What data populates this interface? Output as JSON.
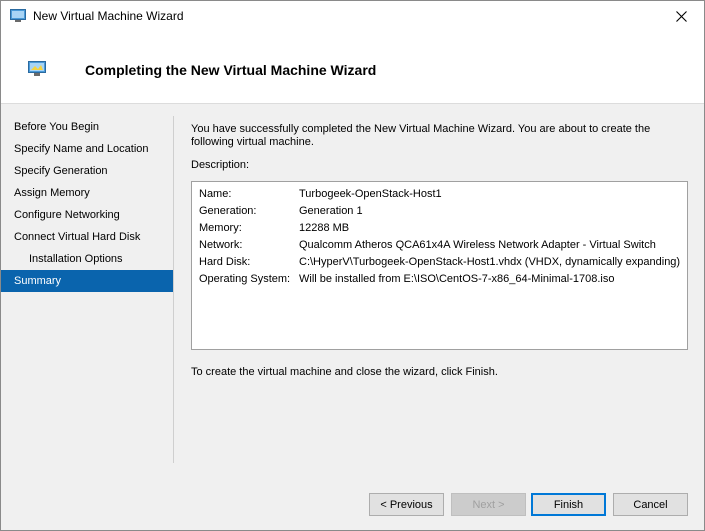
{
  "window": {
    "title": "New Virtual Machine Wizard",
    "header_title": "Completing the New Virtual Machine Wizard"
  },
  "nav": {
    "items": [
      {
        "label": "Before You Begin"
      },
      {
        "label": "Specify Name and Location"
      },
      {
        "label": "Specify Generation"
      },
      {
        "label": "Assign Memory"
      },
      {
        "label": "Configure Networking"
      },
      {
        "label": "Connect Virtual Hard Disk"
      },
      {
        "label": "Installation Options"
      },
      {
        "label": "Summary"
      }
    ]
  },
  "content": {
    "intro": "You have successfully completed the New Virtual Machine Wizard. You are about to create the following virtual machine.",
    "description_label": "Description:",
    "rows": [
      {
        "key": "Name:",
        "value": "Turbogeek-OpenStack-Host1"
      },
      {
        "key": "Generation:",
        "value": "Generation 1"
      },
      {
        "key": "Memory:",
        "value": "12288 MB"
      },
      {
        "key": "Network:",
        "value": "Qualcomm Atheros QCA61x4A Wireless Network Adapter - Virtual Switch"
      },
      {
        "key": "Hard Disk:",
        "value": "C:\\HyperV\\Turbogeek-OpenStack-Host1.vhdx (VHDX, dynamically expanding)"
      },
      {
        "key": "Operating System:",
        "value": "Will be installed from E:\\ISO\\CentOS-7-x86_64-Minimal-1708.iso"
      }
    ],
    "finish_text": "To create the virtual machine and close the wizard, click Finish."
  },
  "buttons": {
    "previous": "< Previous",
    "next": "Next >",
    "finish": "Finish",
    "cancel": "Cancel"
  },
  "colors": {
    "selection": "#0a64ad",
    "default_button_border": "#0078d7"
  }
}
